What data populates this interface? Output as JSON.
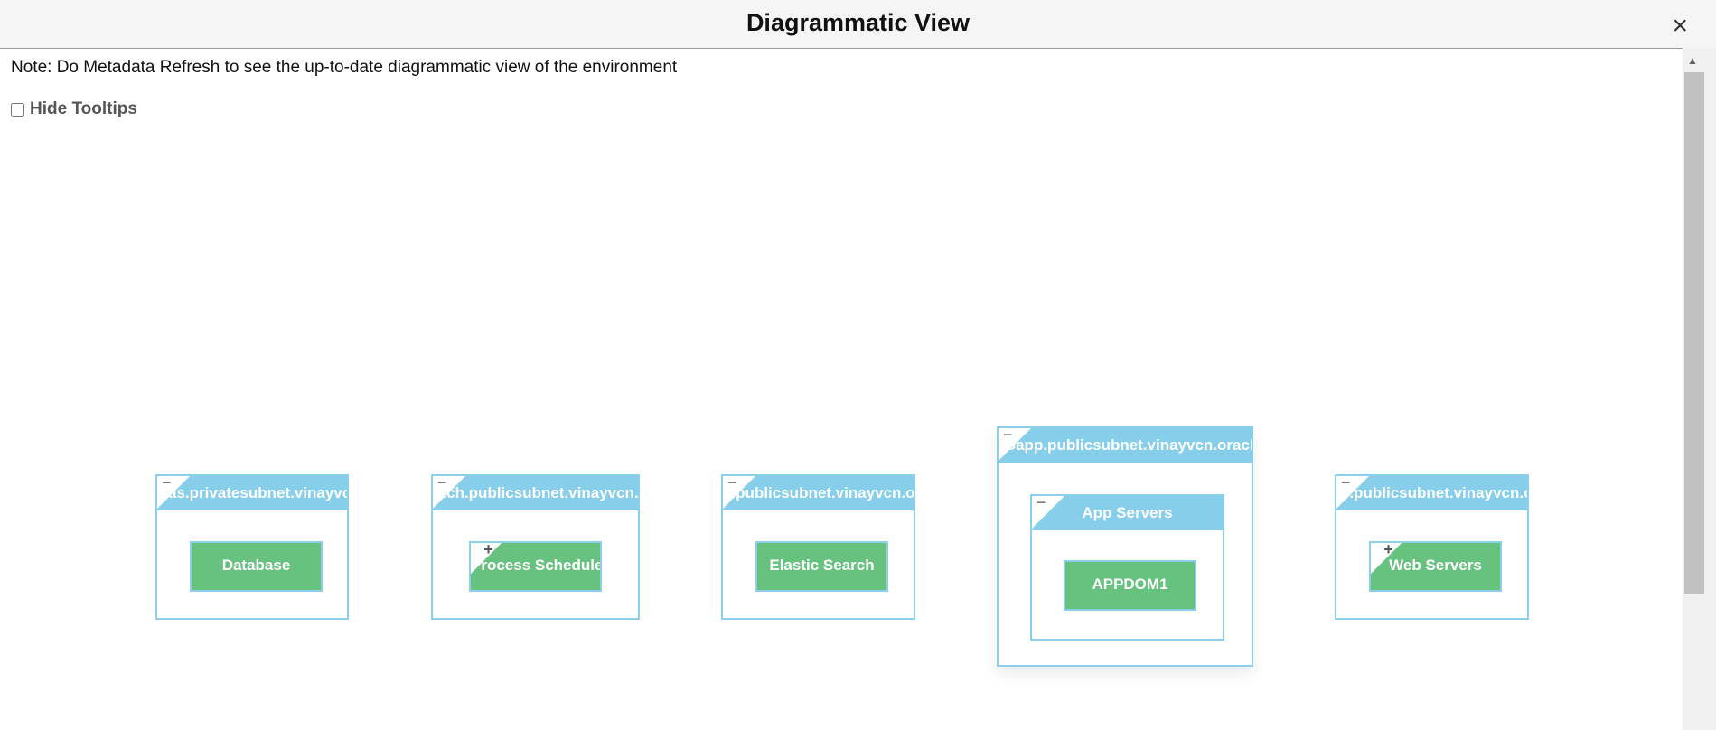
{
  "dialog": {
    "title": "Diagrammatic View",
    "close_symbol": "×"
  },
  "note": "Note: Do Metadata Refresh to see the up-to-date diagrammatic view of the environment",
  "hide_tooltips": {
    "label": "Hide Tooltips",
    "checked": false
  },
  "diagram": {
    "nodes": [
      {
        "host": "as.privatesubnet.vinayvcn.oraclevcn.com",
        "fold": "−",
        "leaf": {
          "label": "Database",
          "fold": ""
        }
      },
      {
        "host": "atch.publicsubnet.vinayvcn.oraclevcn.com",
        "fold": "−",
        "leaf": {
          "label": "Process Scheduler",
          "fold": "+"
        }
      },
      {
        "host": "k.publicsubnet.vinayvcn.oraclevcn.com",
        "fold": "−",
        "leaf": {
          "label": "Elastic Search",
          "fold": ""
        }
      },
      {
        "host": "ioapp.publicsubnet.vinayvcn.oraclevcn.com",
        "fold": "−",
        "group": {
          "label": "App Servers",
          "fold": "−",
          "leaf": {
            "label": "APPDOM1"
          }
        }
      },
      {
        "host": "b.publicsubnet.vinayvcn.oraclevcn.com",
        "fold": "−",
        "leaf": {
          "label": "Web Servers",
          "fold": "+"
        }
      }
    ]
  },
  "colors": {
    "header_blue": "#87ceeb",
    "leaf_green": "#68c27f",
    "border_blue": "#8ccfea"
  },
  "icons": {
    "close": "close-icon",
    "collapse": "collapse-icon",
    "expand": "expand-icon"
  }
}
